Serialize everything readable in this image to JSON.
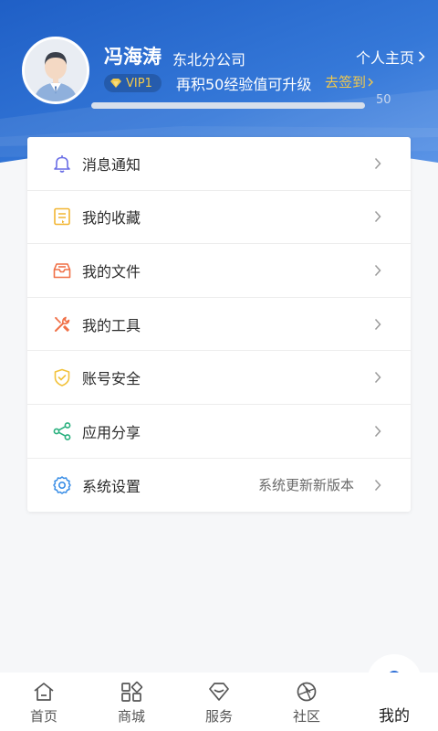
{
  "profile": {
    "name": "冯海涛",
    "company": "东北分公司",
    "homepage_label": "个人主页",
    "vip_level": "VIP1",
    "upgrade_text": "再积50经验值可升级",
    "signin_label": "去签到",
    "progress_fraction": 0.0,
    "progress_max": "50"
  },
  "menu": {
    "items": [
      {
        "label": "消息通知",
        "icon": "bell-icon",
        "color": "#6a6ee6"
      },
      {
        "label": "我的收藏",
        "icon": "favorites-icon",
        "color": "#f2b632"
      },
      {
        "label": "我的文件",
        "icon": "file-tray-icon",
        "color": "#f07047"
      },
      {
        "label": "我的工具",
        "icon": "tools-icon",
        "color": "#f07047"
      },
      {
        "label": "账号安全",
        "icon": "shield-icon",
        "color": "#f2c23a"
      },
      {
        "label": "应用分享",
        "icon": "share-icon",
        "color": "#29b07e"
      },
      {
        "label": "系统设置",
        "icon": "gear-icon",
        "color": "#3a8ee6",
        "extra": "系统更新新版本"
      }
    ]
  },
  "nav": {
    "items": [
      {
        "label": "首页",
        "icon": "home-icon"
      },
      {
        "label": "商城",
        "icon": "grid-icon"
      },
      {
        "label": "服务",
        "icon": "diamond-icon"
      },
      {
        "label": "社区",
        "icon": "aperture-icon"
      },
      {
        "label": "我的",
        "icon": "user-icon",
        "active": true
      }
    ]
  },
  "colors": {
    "header_blue": "#2f6fcf",
    "accent_blue": "#2e6fd6",
    "vip_gold": "#f2c94c"
  }
}
